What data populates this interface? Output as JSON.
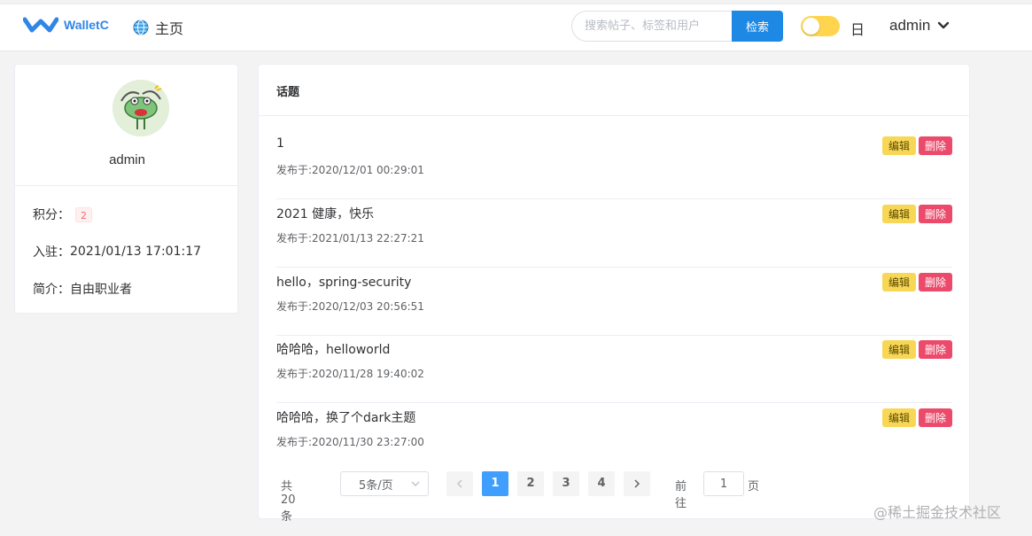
{
  "header": {
    "logo_text": "WalletC",
    "home_label": "主页",
    "search": {
      "placeholder": "搜索帖子、标签和用户",
      "button_label": "检索"
    },
    "mode_label": "日",
    "username": "admin",
    "accent_color": "#1e88e5",
    "toggle_color": "#ffd54f"
  },
  "profile": {
    "name": "admin",
    "score_label": "积分：",
    "score_value": "2",
    "joined_label": "入驻：",
    "joined_value": "2021/01/13 17:01:17",
    "bio_label": "简介：",
    "bio_value": "自由职业者"
  },
  "topics": {
    "header": "话题",
    "edit_label": "编辑",
    "delete_label": "删除",
    "items": [
      {
        "title": "1",
        "date": "发布于:2020/12/01 00:29:01"
      },
      {
        "title": "2021 健康，快乐",
        "date": "发布于:2021/01/13 22:27:21"
      },
      {
        "title": "hello，spring-security",
        "date": "发布于:2020/12/03 20:56:51"
      },
      {
        "title": "哈哈哈，helloworld",
        "date": "发布于:2020/11/28 19:40:02"
      },
      {
        "title": "哈哈哈，换了个dark主题",
        "date": "发布于:2020/11/30 23:27:00"
      }
    ]
  },
  "pagination": {
    "total_text": "共 20 条",
    "page_size": "5条/页",
    "pages": [
      "1",
      "2",
      "3",
      "4"
    ],
    "current_page": "1",
    "goto_label": "前往",
    "goto_value": "1",
    "goto_suffix": "页"
  },
  "watermark": "@稀土掘金技术社区"
}
